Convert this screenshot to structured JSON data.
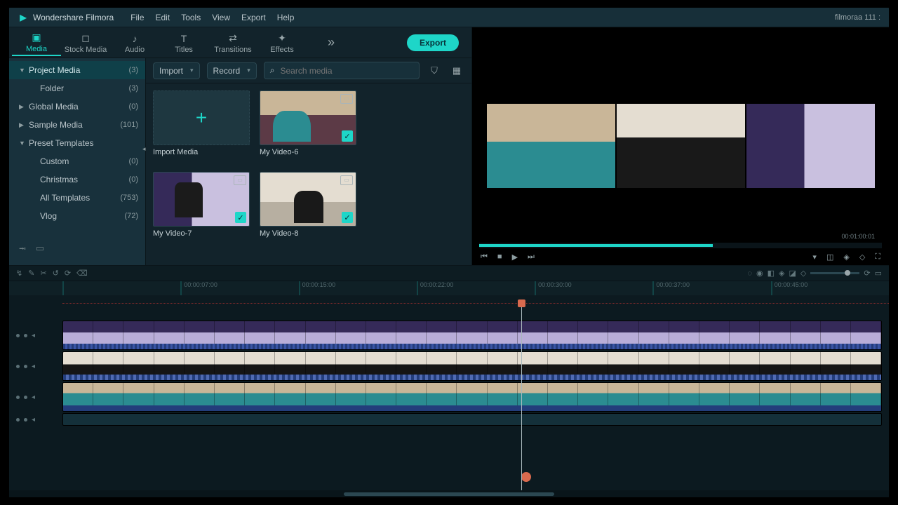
{
  "titlebar": {
    "app_name": "Wondershare Filmora",
    "menu": [
      "File",
      "Edit",
      "Tools",
      "View",
      "Export",
      "Help"
    ],
    "project_indicator": "filmoraa 111 :"
  },
  "tabs": {
    "items": [
      {
        "label": "Media",
        "icon": "▣"
      },
      {
        "label": "Stock Media",
        "icon": "◻"
      },
      {
        "label": "Audio",
        "icon": "♪"
      },
      {
        "label": "Titles",
        "icon": "T"
      },
      {
        "label": "Transitions",
        "icon": "⇄"
      },
      {
        "label": "Effects",
        "icon": "✦"
      }
    ],
    "active": 0,
    "export_label": "Export",
    "overflow": "»"
  },
  "sidebar": {
    "items": [
      {
        "name": "Project Media",
        "count": "(3)",
        "caret": "▼",
        "selected": true,
        "child": false
      },
      {
        "name": "Folder",
        "count": "(3)",
        "caret": "",
        "selected": false,
        "child": true
      },
      {
        "name": "Global Media",
        "count": "(0)",
        "caret": "▶",
        "selected": false,
        "child": false
      },
      {
        "name": "Sample Media",
        "count": "(101)",
        "caret": "▶",
        "selected": false,
        "child": false
      },
      {
        "name": "Preset Templates",
        "count": "",
        "caret": "▼",
        "selected": false,
        "child": false
      },
      {
        "name": "Custom",
        "count": "(0)",
        "caret": "",
        "selected": false,
        "child": true
      },
      {
        "name": "Christmas",
        "count": "(0)",
        "caret": "",
        "selected": false,
        "child": true
      },
      {
        "name": "All Templates",
        "count": "(753)",
        "caret": "",
        "selected": false,
        "child": true
      },
      {
        "name": "Vlog",
        "count": "(72)",
        "caret": "",
        "selected": false,
        "child": true
      }
    ],
    "foot_icons": [
      "⭲",
      "▭"
    ]
  },
  "media_toolbar": {
    "import_label": "Import",
    "record_label": "Record",
    "search_placeholder": "Search media",
    "filter_icon": "⛉",
    "view_icon": "▦"
  },
  "media_grid": {
    "items": [
      {
        "label": "Import Media",
        "kind": "import"
      },
      {
        "label": "My Video-6",
        "kind": "v6"
      },
      {
        "label": "My Video-7",
        "kind": "v7"
      },
      {
        "label": "My Video-8",
        "kind": "v8"
      }
    ]
  },
  "preview": {
    "timecode": "00:01:00:01",
    "controls": {
      "prev": "⏮",
      "stop": "■",
      "play": "▶",
      "next": "⏭"
    }
  },
  "tool_right": {
    "icons": [
      "◌",
      "◉",
      "◧",
      "◈",
      "◪",
      "◇"
    ],
    "end_icons": [
      "⟳",
      "▭"
    ]
  },
  "timeline": {
    "ruler": [
      "",
      "00:00:07:00",
      "00:00:15:00",
      "00:00:22:00",
      "00:00:30:00",
      "00:00:37:00",
      "00:00:45:00"
    ],
    "left_tools": [
      "↯",
      "✎",
      "✂",
      "↺",
      "⟳",
      "⌫"
    ],
    "tracks": [
      {
        "head": "• • ◂",
        "type": "video",
        "clip": "v7"
      },
      {
        "head": "• • ◂",
        "type": "video",
        "clip": "v8"
      },
      {
        "head": "• • ◂",
        "type": "video",
        "clip": "v6"
      },
      {
        "head": "• • ◂",
        "type": "audio",
        "clip": "audio"
      }
    ]
  }
}
